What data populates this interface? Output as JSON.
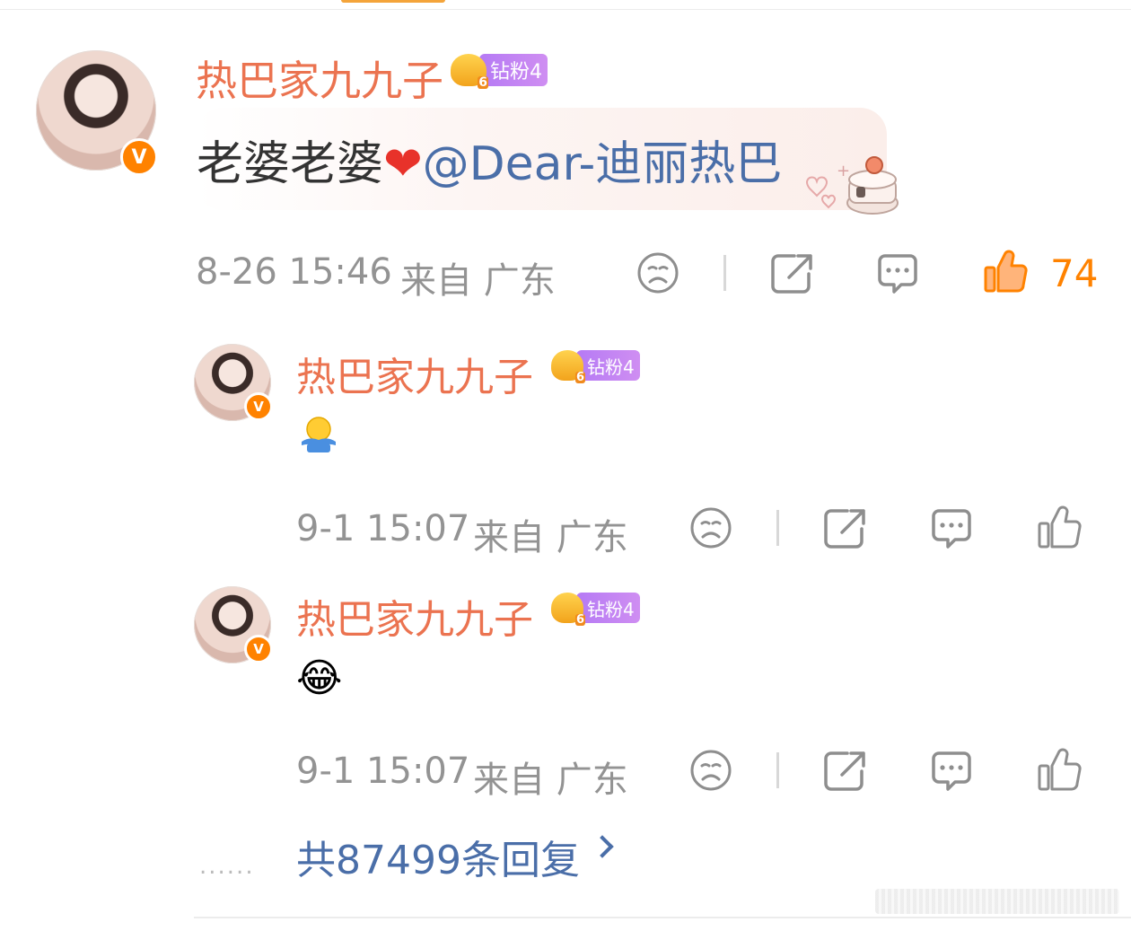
{
  "main_comment": {
    "username": "热巴家九九子",
    "badge_crown_level": "6",
    "badge_label": "钻粉4",
    "content_prefix": "老婆老婆",
    "content_mention": "@Dear-迪丽热巴",
    "time": "8-26 15:46",
    "source": "来自 广东",
    "like_count": "74",
    "icons": [
      "sad-face-icon",
      "share-icon",
      "comment-icon",
      "thumbs-up-icon"
    ]
  },
  "replies": [
    {
      "username": "热巴家九九子",
      "badge_crown_level": "6",
      "badge_label": "钻粉4",
      "emoji": "hug-emoji",
      "time": "9-1 15:07",
      "source": "来自 广东"
    },
    {
      "username": "热巴家九九子",
      "badge_crown_level": "6",
      "badge_label": "钻粉4",
      "emoji": "😂",
      "time": "9-1 15:07",
      "source": "来自 广东"
    }
  ],
  "more_replies": {
    "dots": "......",
    "label": "共87499条回复"
  },
  "colors": {
    "username": "#eb7350",
    "mention": "#4a6ea8",
    "meta": "#939393",
    "like_active": "#ff8200",
    "badge": "#c285f3"
  }
}
